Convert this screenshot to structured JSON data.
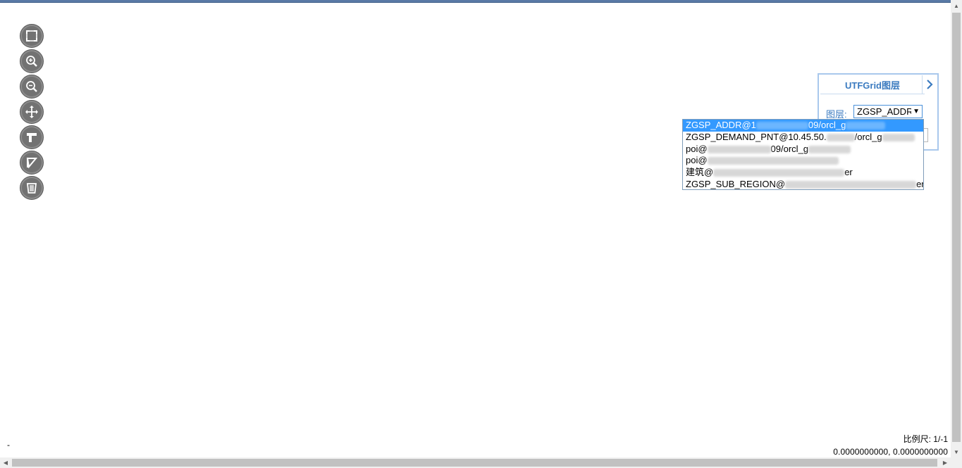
{
  "toolbar": {
    "tools": [
      {
        "name": "full-extent-icon"
      },
      {
        "name": "zoom-in-icon"
      },
      {
        "name": "zoom-out-icon"
      },
      {
        "name": "pan-icon"
      },
      {
        "name": "measure-distance-icon"
      },
      {
        "name": "measure-area-icon"
      },
      {
        "name": "clear-icon"
      }
    ]
  },
  "panel": {
    "title": "UTFGrid图层",
    "layer_label": "图层:",
    "selected_layer": "ZGSP_ADDR",
    "toggle_icon": "chevron-right-icon"
  },
  "dropdown": {
    "options": [
      {
        "prefix": "ZGSP_ADDR@1",
        "suffix": "09/orcl_g"
      },
      {
        "prefix": "ZGSP_DEMAND_PNT@10.45.50.",
        "suffix": "/orcl_g"
      },
      {
        "prefix": "poi@",
        "suffix": "09/orcl_g"
      },
      {
        "prefix": "poi@",
        "suffix": ""
      },
      {
        "prefix": "建筑@",
        "suffix": "er"
      },
      {
        "prefix": "ZGSP_SUB_REGION@",
        "suffix": "er"
      }
    ]
  },
  "status": {
    "scale": "比例尺:  1/-1",
    "coords": "0.0000000000, 0.0000000000",
    "dash": "-"
  },
  "colors": {
    "accent": "#3b7bc0",
    "panel_border": "#a9c8ec",
    "selected": "#3399ff"
  }
}
